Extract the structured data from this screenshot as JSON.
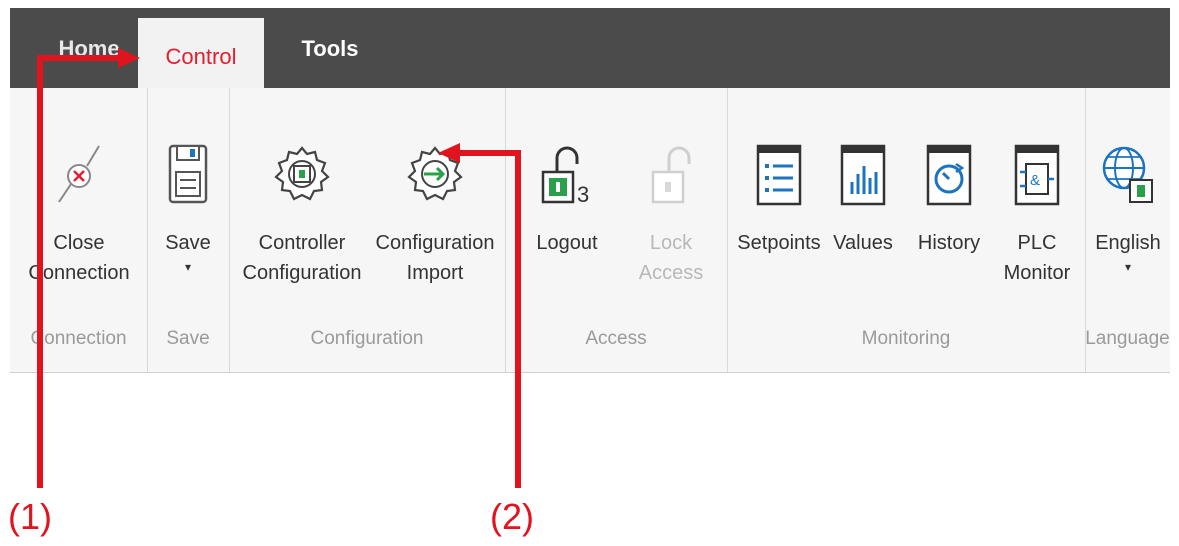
{
  "tabs": {
    "home": "Home",
    "control": "Control",
    "tools": "Tools"
  },
  "ribbon": {
    "connection": {
      "label": "Connection",
      "close_line1": "Close",
      "close_line2": "Connection"
    },
    "save": {
      "label": "Save",
      "save_button": "Save",
      "dropdown": "▾"
    },
    "configuration": {
      "label": "Configuration",
      "controller_line1": "Controller",
      "controller_line2": "Configuration",
      "import_line1": "Configuration",
      "import_line2": "Import"
    },
    "access": {
      "label": "Access",
      "logout": "Logout",
      "lock_line1": "Lock",
      "lock_line2": "Access",
      "logout_badge": "3"
    },
    "monitoring": {
      "label": "Monitoring",
      "setpoints": "Setpoints",
      "values": "Values",
      "history": "History",
      "plc_line1": "PLC",
      "plc_line2": "Monitor"
    },
    "language": {
      "label": "Language",
      "selected": "English",
      "dropdown": "▾"
    }
  },
  "annotations": {
    "one": "(1)",
    "two": "(2)"
  },
  "colors": {
    "annotation": "#e0141e",
    "tabbar": "#4b4b4b",
    "accent_green": "#2aa04a",
    "accent_blue": "#1e73be"
  }
}
